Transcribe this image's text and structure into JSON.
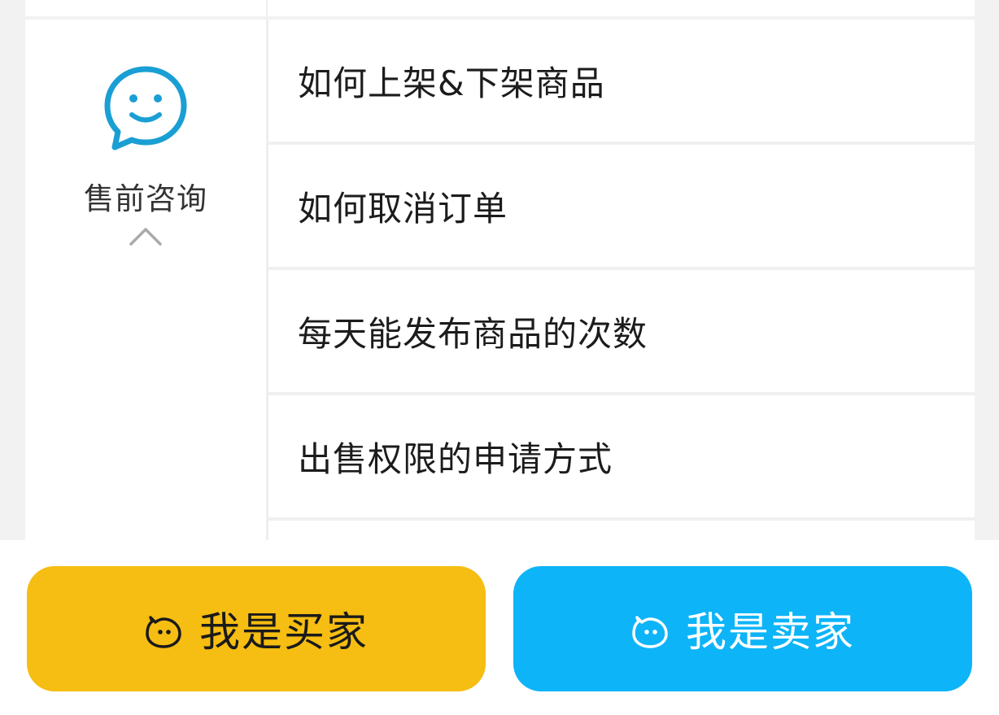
{
  "category": {
    "label": "售前咨询",
    "icon": "smile-chat-bubble-icon",
    "expand_icon": "chevron-up-icon",
    "accent_color": "#1a9fd4"
  },
  "faq": {
    "items": [
      {
        "label": "如何上架&下架商品"
      },
      {
        "label": "如何取消订单"
      },
      {
        "label": "每天能发布商品的次数"
      },
      {
        "label": "出售权限的申请方式"
      }
    ]
  },
  "actions": {
    "buyer": {
      "label": "我是买家",
      "color": "#f6bd12",
      "icon": "cat-face-icon"
    },
    "seller": {
      "label": "我是卖家",
      "color": "#0db4f8",
      "icon": "cat-face-icon"
    }
  }
}
